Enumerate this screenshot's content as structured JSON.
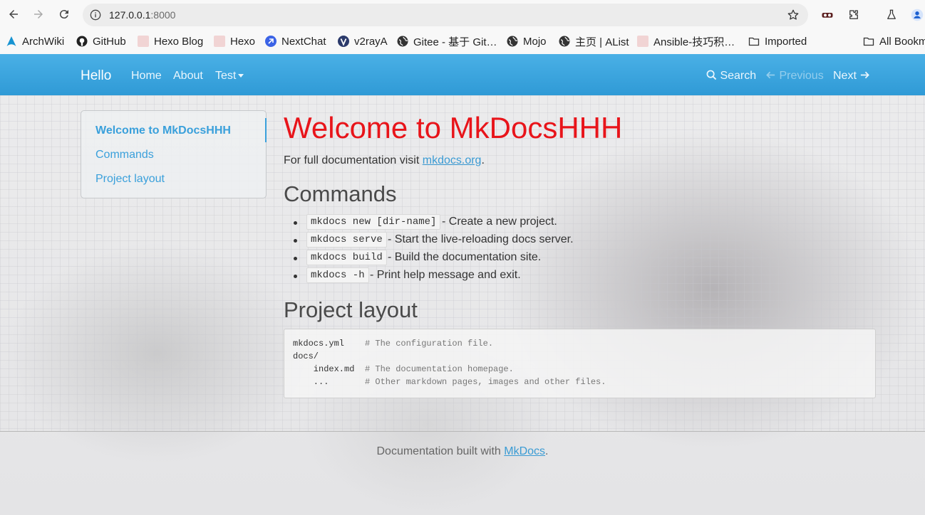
{
  "browser": {
    "url_host": "127.0.0.1",
    "url_port": ":8000",
    "bookmarks": [
      {
        "label": "ArchWiki",
        "icon": "archlinux-icon"
      },
      {
        "label": "GitHub",
        "icon": "github-icon"
      },
      {
        "label": "Hexo Blog",
        "icon": "hexo-icon"
      },
      {
        "label": "Hexo",
        "icon": "hexo-icon"
      },
      {
        "label": "NextChat",
        "icon": "nextchat-icon"
      },
      {
        "label": "v2rayA",
        "icon": "v2raya-icon"
      },
      {
        "label": "Gitee - 基于 Git…",
        "icon": "globe-icon"
      },
      {
        "label": "Mojo",
        "icon": "globe-icon"
      },
      {
        "label": "主页 | AList",
        "icon": "globe-icon"
      },
      {
        "label": "Ansible-技巧积…",
        "icon": "hexo-icon"
      },
      {
        "label": "Imported",
        "icon": "folder-icon"
      },
      {
        "label": "All Bookmarks",
        "icon": "folder-icon"
      }
    ]
  },
  "site": {
    "brand": "Hello",
    "nav": {
      "home": "Home",
      "about": "About",
      "test": "Test"
    },
    "search": "Search",
    "previous": "Previous",
    "next": "Next"
  },
  "sidebar": {
    "items": [
      "Welcome to MkDocsHHH",
      "Commands",
      "Project layout"
    ]
  },
  "content": {
    "title": "Welcome to MkDocsHHH",
    "intro_prefix": "For full documentation visit ",
    "intro_link": "mkdocs.org",
    "intro_suffix": ".",
    "commands_heading": "Commands",
    "commands": [
      {
        "code": "mkdocs new [dir-name]",
        "desc": "- Create a new project."
      },
      {
        "code": "mkdocs serve",
        "desc": "- Start the live-reloading docs server."
      },
      {
        "code": "mkdocs build",
        "desc": "- Build the documentation site."
      },
      {
        "code": "mkdocs -h",
        "desc": "- Print help message and exit."
      }
    ],
    "layout_heading": "Project layout",
    "layout_lines": [
      {
        "text": "mkdocs.yml",
        "comment": "# The configuration file."
      },
      {
        "text": "docs/",
        "comment": ""
      },
      {
        "text": "    index.md",
        "comment": "# The documentation homepage."
      },
      {
        "text": "    ...",
        "comment": "# Other markdown pages, images and other files."
      }
    ]
  },
  "footer": {
    "prefix": "Documentation built with ",
    "link": "MkDocs",
    "suffix": "."
  },
  "colors": {
    "navbar": "#2f9ad6",
    "title": "#e8141a",
    "link": "#3a9bd4"
  }
}
